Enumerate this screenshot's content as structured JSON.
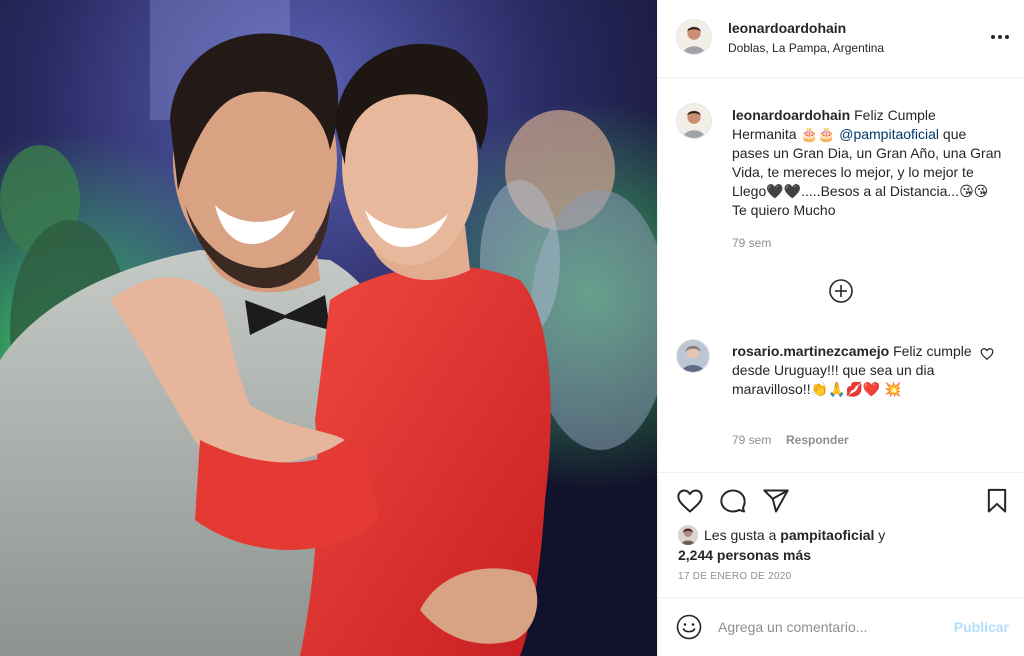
{
  "colors": {
    "link": "#00376b",
    "muted": "#8e8e8e",
    "publish_disabled": "#b2dffc",
    "heart_emoji": "#e0245e"
  },
  "post": {
    "author": {
      "username": "leonardoardohain",
      "location": "Doblas, La Pampa, Argentina"
    },
    "caption": {
      "username": "leonardoardohain",
      "text_before": "Feliz Cumple Hermanita 🎂🎂 ",
      "mention": "@pampitaoficial",
      "text_after": " que pases un Gran Dia, un Gran Año, una Gran Vida, te mereces lo mejor, y lo mejor te Llego🖤🖤.....Besos a al Distancia...😘😘 Te quiero Mucho",
      "time": "79 sem"
    },
    "comments": [
      {
        "username": "rosario.martinezcamejo",
        "text": "Feliz cumple desde Uruguay!!! que sea un dia maravilloso!!👏🙏💋❤️ 💥",
        "time": "79 sem",
        "reply_label": "Responder"
      }
    ],
    "likes": {
      "prefix": "Les gusta a ",
      "liked_by": "pampitaoficial",
      "connector": " y",
      "others": "2,244 personas más"
    },
    "date": "17 DE ENERO DE 2020",
    "add_comment": {
      "placeholder": "Agrega un comentario...",
      "publish_label": "Publicar"
    }
  }
}
